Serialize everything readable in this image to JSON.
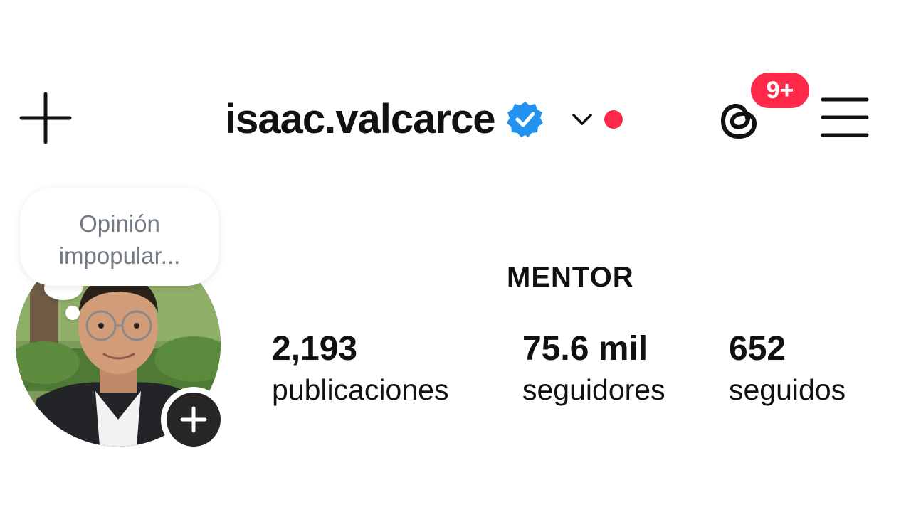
{
  "header": {
    "create_icon": "plus-icon",
    "username": "isaac.valcarce",
    "verified_icon": "verified-badge-icon",
    "switch_account_icon": "chevron-down-icon",
    "notification_dot_color": "#ff2a4a",
    "threads_icon": "threads-icon",
    "threads_badge": "9+",
    "menu_icon": "hamburger-menu-icon"
  },
  "profile": {
    "note_line1": "Opinión",
    "note_line2": "impopular...",
    "add_story_icon": "plus-icon",
    "category": "MENTOR",
    "stats": {
      "posts_value": "2,193",
      "posts_label": "publicaciones",
      "followers_value": "75.6 mil",
      "followers_label": "seguidores",
      "following_value": "652",
      "following_label": "seguidos"
    }
  },
  "colors": {
    "accent_red": "#ff2a4a",
    "verified_blue": "#2493f0",
    "note_text": "#737985",
    "text": "#111111"
  }
}
